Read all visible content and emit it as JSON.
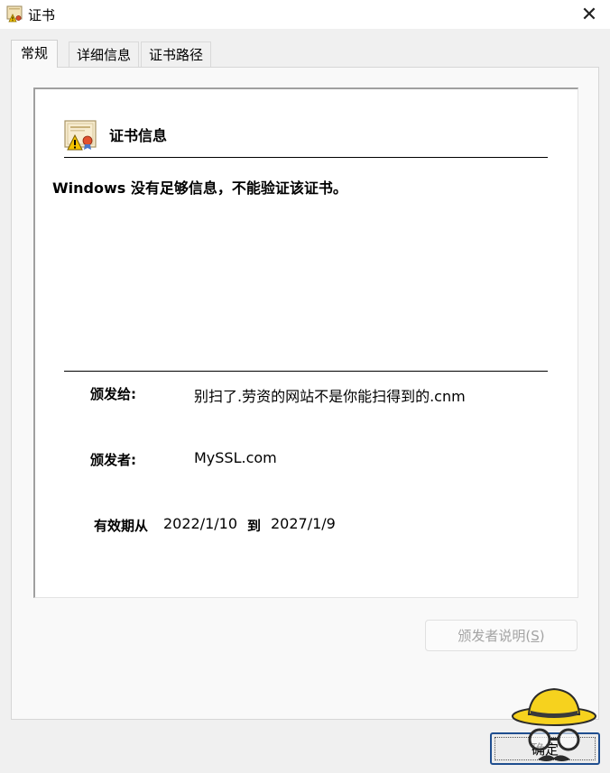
{
  "window": {
    "title": "证书",
    "close_glyph": "✕"
  },
  "tabs": [
    {
      "label": "常规",
      "active": true
    },
    {
      "label": "详细信息",
      "active": false
    },
    {
      "label": "证书路径",
      "active": false
    }
  ],
  "general": {
    "heading": "证书信息",
    "warning": "Windows 没有足够信息，不能验证该证书。",
    "issued_to_label": "颁发给:",
    "issued_to_value": "别扫了.劳资的网站不是你能扫得到的.cnm",
    "issued_by_label": "颁发者:",
    "issued_by_value": "MySSL.com",
    "valid_from_label": "有效期从",
    "valid_from_value": "2022/1/10",
    "valid_to_label": "到",
    "valid_to_value": "2027/1/9"
  },
  "buttons": {
    "issuer_statement_prefix": "颁发者说明(",
    "issuer_statement_hotkey": "S",
    "issuer_statement_suffix": ")",
    "ok": "确定"
  },
  "icons": {
    "title_icon": "certificate-warning-icon",
    "info_icon": "certificate-warning-icon",
    "overlay": "mascot-hat-glasses-icon"
  },
  "colors": {
    "window_bg": "#f0f0f0",
    "ok_border": "#1f4e8f",
    "warning_yellow": "#f2c200"
  }
}
